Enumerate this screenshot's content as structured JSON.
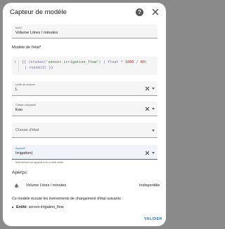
{
  "dialog": {
    "title": "Capteur de modèle",
    "help_icon": "help-circle-icon",
    "close_icon": "close-icon"
  },
  "name_field": {
    "label": "Nom*",
    "value": "Volume Litres / minutes"
  },
  "template": {
    "label": "Modèle de l'état*",
    "line_number": "1",
    "line1_open": "{{ ",
    "line1_expr_a": "(states(",
    "line1_string": "'sensor.irrigation_flow'",
    "line1_expr_b": ") | float * ",
    "line1_num1": "1000",
    "line1_expr_c": " / ",
    "line1_num2": "60",
    "line1_expr_d": ")",
    "line2_pipe": "| ",
    "line2_expr": "round(2)",
    "line2_close": " }}"
  },
  "unit_field": {
    "label": "Unité de mesure",
    "value": "L"
  },
  "device_class_field": {
    "label": "Classe d'appareil",
    "value": "Eau"
  },
  "state_class_field": {
    "placeholder": "Classe d'état"
  },
  "device_field": {
    "label": "Appareil",
    "value": "Irrigation|",
    "helper": "Sélectionnez un appareil à lier à cette entité."
  },
  "preview": {
    "title": "Aperçu:",
    "entity_icon": "water-drop-icon",
    "entity_name": "Volume Litres / minutes",
    "entity_state": "Indisponible",
    "listens_text": "Ce modèle écoute les événements de changement d'état suivants :",
    "bullet_label": "Entité",
    "bullet_value": ": sensor.irrigation_flow"
  },
  "footer": {
    "save_label": "VALIDER"
  },
  "colors": {
    "accent": "#1976d2",
    "backdrop": "#8a8a8a"
  }
}
